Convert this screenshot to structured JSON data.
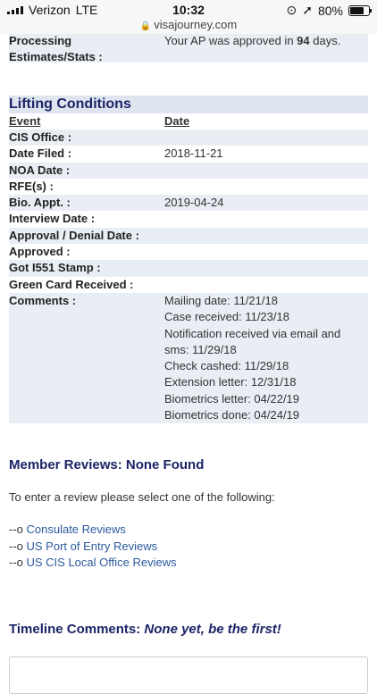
{
  "status": {
    "carrier": "Verizon",
    "network": "LTE",
    "time": "10:32",
    "battery": "80%",
    "battery_level": 0.8
  },
  "url": "visajourney.com",
  "processing": {
    "label": "Processing Estimates/Stats :",
    "value_prefix": "Your AP was approved in ",
    "value_days": "94",
    "value_suffix": " days."
  },
  "lifting": {
    "title": "Lifting Conditions",
    "col_event": "Event",
    "col_date": "Date",
    "rows": [
      {
        "label": "CIS Office :",
        "value": ""
      },
      {
        "label": "Date Filed :",
        "value": "2018-11-21"
      },
      {
        "label": "NOA Date :",
        "value": ""
      },
      {
        "label": "RFE(s) :",
        "value": ""
      },
      {
        "label": "Bio. Appt. :",
        "value": "2019-04-24"
      },
      {
        "label": "Interview Date :",
        "value": ""
      },
      {
        "label": "Approval / Denial Date :",
        "value": ""
      },
      {
        "label": "Approved :",
        "value": ""
      },
      {
        "label": "Got I551 Stamp :",
        "value": ""
      },
      {
        "label": "Green Card Received :",
        "value": ""
      }
    ],
    "comments_label": "Comments :",
    "comments": [
      "Mailing date: 11/21/18",
      "Case received: 11/23/18",
      "Notification received via email and",
      "sms: 11/29/18",
      "Check cashed: 11/29/18",
      "Extension letter: 12/31/18",
      "Biometrics letter: 04/22/19",
      "Biometrics done: 04/24/19"
    ]
  },
  "reviews": {
    "title": "Member Reviews: None Found",
    "prompt": "To enter a review please select one of the following:",
    "prefix": "--o ",
    "links": [
      "Consulate Reviews",
      "US Port of Entry Reviews",
      "US CIS Local Office Reviews"
    ]
  },
  "timeline": {
    "label": "Timeline Comments: ",
    "emphasis": "None yet, be the first!"
  },
  "colors": {
    "heading": "#1b2466",
    "shade": "#e9eef5",
    "link": "#2c5a9e"
  },
  "icons": [
    "signal-icon",
    "location-arrow-icon",
    "lock-icon",
    "battery-icon",
    "rotation-lock-icon"
  ]
}
